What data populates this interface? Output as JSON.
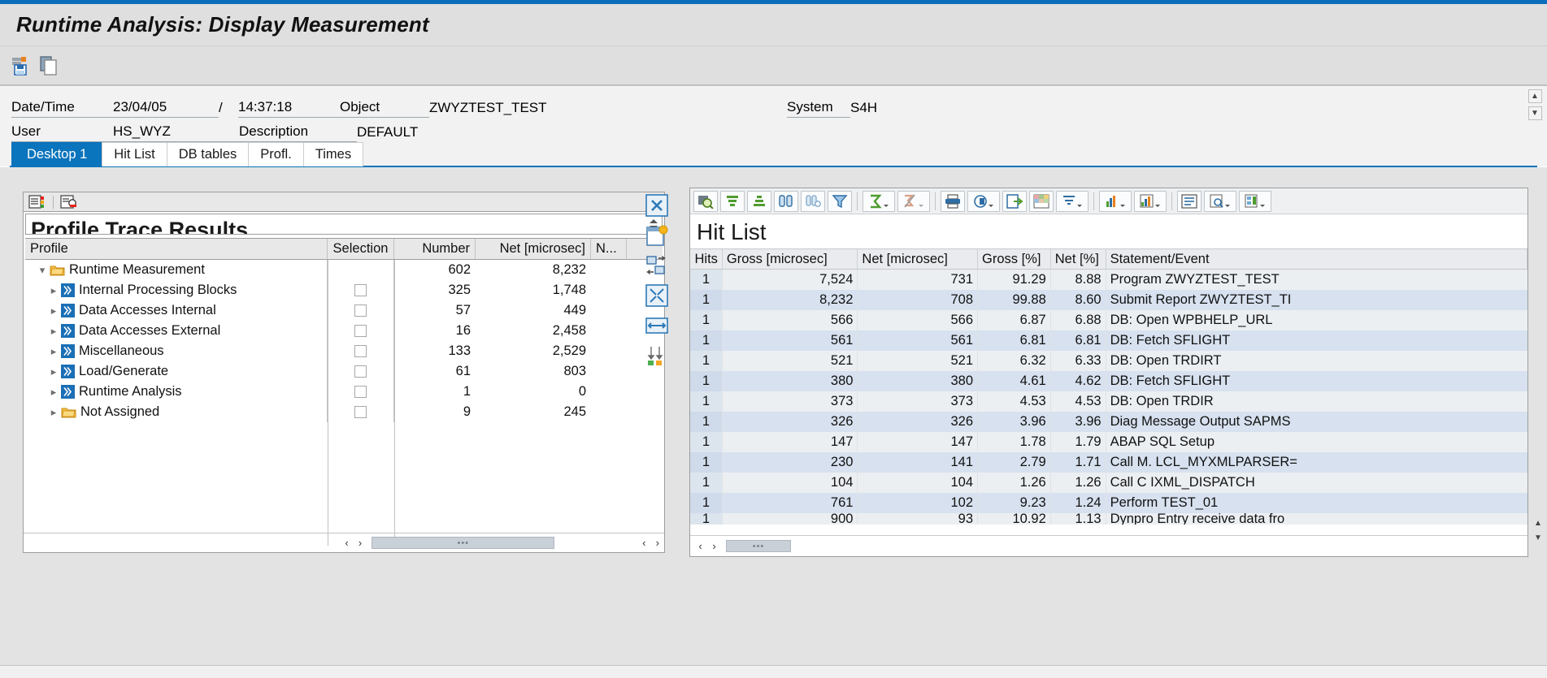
{
  "app": {
    "title": "Runtime Analysis: Display Measurement",
    "accent_color": "#0a74bc"
  },
  "main_toolbar": {
    "buttons": [
      {
        "name": "save-as-icon",
        "label": "Save As"
      },
      {
        "name": "copy-icon",
        "label": "Copy"
      }
    ]
  },
  "header": {
    "date_time_label": "Date/Time",
    "date_value": "23/04/05",
    "date_separator": "/",
    "time_value": "14:37:18",
    "object_label": "Object",
    "object_value": "ZWYZTEST_TEST",
    "system_label": "System",
    "system_value": "S4H",
    "user_label": "User",
    "user_value": "HS_WYZ",
    "description_label": "Description",
    "description_value": "DEFAULT"
  },
  "tabs": [
    {
      "label": "Desktop 1",
      "active": true
    },
    {
      "label": "Hit List",
      "active": false
    },
    {
      "label": "DB tables",
      "active": false
    },
    {
      "label": "Profl.",
      "active": false
    },
    {
      "label": "Times",
      "active": false
    }
  ],
  "left_panel": {
    "title": "Profile Trace Results",
    "columns": [
      "Profile",
      "Selection",
      "Number",
      "Net [microsec]",
      "N..."
    ],
    "rows": [
      {
        "label": "Runtime Measurement",
        "icon": "folder-icon",
        "level": 0,
        "expanded": true,
        "has_checkbox": false,
        "number": "602",
        "net": "8,232"
      },
      {
        "label": "Internal Processing Blocks",
        "icon": "block-icon",
        "level": 1,
        "expanded": false,
        "has_checkbox": true,
        "number": "325",
        "net": "1,748"
      },
      {
        "label": "Data Accesses Internal",
        "icon": "block-icon",
        "level": 1,
        "expanded": false,
        "has_checkbox": true,
        "number": "57",
        "net": "449"
      },
      {
        "label": "Data Accesses External",
        "icon": "block-icon",
        "level": 1,
        "expanded": false,
        "has_checkbox": true,
        "number": "16",
        "net": "2,458"
      },
      {
        "label": "Miscellaneous",
        "icon": "block-icon",
        "level": 1,
        "expanded": false,
        "has_checkbox": true,
        "number": "133",
        "net": "2,529"
      },
      {
        "label": "Load/Generate",
        "icon": "block-icon",
        "level": 1,
        "expanded": false,
        "has_checkbox": true,
        "number": "61",
        "net": "803"
      },
      {
        "label": "Runtime Analysis",
        "icon": "block-icon",
        "level": 1,
        "expanded": false,
        "has_checkbox": true,
        "number": "1",
        "net": "0"
      },
      {
        "label": "Not Assigned",
        "icon": "folder-icon",
        "level": 1,
        "expanded": false,
        "has_checkbox": true,
        "number": "9",
        "net": "245"
      }
    ],
    "toolbar": [
      {
        "name": "list-settings-icon"
      },
      {
        "name": "filter-layout-icon"
      }
    ],
    "scroll_left_label": "‹",
    "scroll_right_label": "›",
    "thumb_grip": "•••"
  },
  "mid_buttons": [
    {
      "name": "close-panel-icon"
    },
    {
      "name": "new-window-icon"
    },
    {
      "name": "transfer-icon"
    },
    {
      "name": "fullscreen-icon"
    },
    {
      "name": "resize-width-icon"
    },
    {
      "name": "sort-toggle-icon"
    }
  ],
  "right_panel": {
    "title": "Hit List",
    "toolbar": [
      {
        "name": "detail-search-icon"
      },
      {
        "name": "sort-ascending-icon"
      },
      {
        "name": "sort-descending-icon"
      },
      {
        "name": "find-icon"
      },
      {
        "name": "find-next-icon"
      },
      {
        "name": "filter-icon"
      },
      {
        "name": "total-sum-icon"
      },
      {
        "name": "subtotal-icon"
      },
      {
        "name": "print-icon"
      },
      {
        "name": "print-preview-icon"
      },
      {
        "name": "export-icon"
      },
      {
        "name": "spreadsheet-icon"
      },
      {
        "name": "download-menu-icon"
      },
      {
        "name": "graphic-icon"
      },
      {
        "name": "abc-analysis-icon"
      },
      {
        "name": "display-detail-icon"
      },
      {
        "name": "search-layout-icon"
      },
      {
        "name": "select-layout-icon"
      }
    ],
    "columns": [
      "Hits",
      "Gross [microsec]",
      "Net [microsec]",
      "Gross [%]",
      "Net [%]",
      "Statement/Event"
    ],
    "rows": [
      {
        "hits": "1",
        "gross": "7,524",
        "net": "731",
        "gross_pct": "91.29",
        "net_pct": "8.88",
        "statement": "Program ZWYZTEST_TEST"
      },
      {
        "hits": "1",
        "gross": "8,232",
        "net": "708",
        "gross_pct": "99.88",
        "net_pct": "8.60",
        "statement": "Submit Report ZWYZTEST_TI"
      },
      {
        "hits": "1",
        "gross": "566",
        "net": "566",
        "gross_pct": "6.87",
        "net_pct": "6.88",
        "statement": "DB: Open WPBHELP_URL"
      },
      {
        "hits": "1",
        "gross": "561",
        "net": "561",
        "gross_pct": "6.81",
        "net_pct": "6.81",
        "statement": "DB: Fetch SFLIGHT"
      },
      {
        "hits": "1",
        "gross": "521",
        "net": "521",
        "gross_pct": "6.32",
        "net_pct": "6.33",
        "statement": "DB: Open TRDIRT"
      },
      {
        "hits": "1",
        "gross": "380",
        "net": "380",
        "gross_pct": "4.61",
        "net_pct": "4.62",
        "statement": "DB: Fetch SFLIGHT"
      },
      {
        "hits": "1",
        "gross": "373",
        "net": "373",
        "gross_pct": "4.53",
        "net_pct": "4.53",
        "statement": "DB: Open TRDIR"
      },
      {
        "hits": "1",
        "gross": "326",
        "net": "326",
        "gross_pct": "3.96",
        "net_pct": "3.96",
        "statement": "Diag Message Output SAPMS"
      },
      {
        "hits": "1",
        "gross": "147",
        "net": "147",
        "gross_pct": "1.78",
        "net_pct": "1.79",
        "statement": "ABAP SQL Setup"
      },
      {
        "hits": "1",
        "gross": "230",
        "net": "141",
        "gross_pct": "2.79",
        "net_pct": "1.71",
        "statement": "Call M. LCL_MYXMLPARSER="
      },
      {
        "hits": "1",
        "gross": "104",
        "net": "104",
        "gross_pct": "1.26",
        "net_pct": "1.26",
        "statement": "Call C IXML_DISPATCH"
      },
      {
        "hits": "1",
        "gross": "761",
        "net": "102",
        "gross_pct": "9.23",
        "net_pct": "1.24",
        "statement": "Perform TEST_01"
      },
      {
        "hits": "1",
        "gross": "900",
        "net": "93",
        "gross_pct": "10.92",
        "net_pct": "1.13",
        "statement": "Dynpro Entry receive data fro"
      }
    ],
    "scroll_left_label": "‹",
    "scroll_right_label": "›",
    "thumb_grip": "•••"
  },
  "window_scroll": {
    "up_label": "▲",
    "down_label": "▼"
  }
}
